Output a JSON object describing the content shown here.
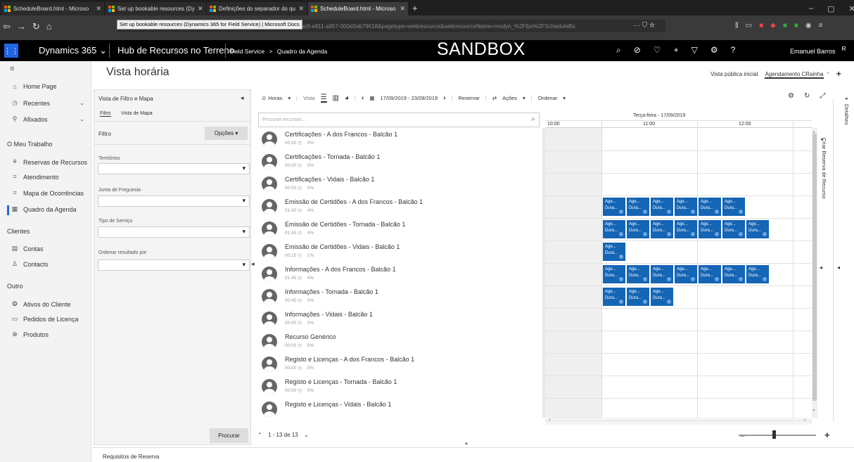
{
  "browser": {
    "tabs": [
      {
        "label": "ScheduleBoard.html - Microso"
      },
      {
        "label": "Set up bookable resources (Dy"
      },
      {
        "label": "Definições do separador do qu"
      },
      {
        "label": "ScheduleBoard.html - Microso"
      }
    ],
    "new_tab": "+",
    "tooltip": "Set up bookable resources (Dynamics 365 for Field Service) | Microsoft Docs",
    "url": "916005-6ac9-e811-a957-000d3ab79618&pagetype=webresource&webresourceName=msdyn_%2Ffps%2FScheduleBo",
    "url_icons": "··· ⛉ ☆",
    "window_controls": [
      "–",
      "▢",
      "✕"
    ]
  },
  "header": {
    "app_name": "Dynamics 365",
    "app_chevron": "⌄",
    "hub_name": "Hub de Recursos no Terreno",
    "breadcrumb_area": "Field Service",
    "breadcrumb_sep": ">",
    "breadcrumb_page": "Quadro da Agenda",
    "environment": "SANDBOX",
    "user": "Emanuel Barros"
  },
  "nav": {
    "items": [
      {
        "label": "Home Page"
      },
      {
        "label": "Recentes"
      },
      {
        "label": "Afixados"
      }
    ],
    "section_work": "O Meu Trabalho",
    "work_items": [
      {
        "label": "Reservas de Recursos"
      },
      {
        "label": "Atendimento"
      },
      {
        "label": "Mapa de Ocorrências"
      },
      {
        "label": "Quadro da Agenda"
      }
    ],
    "section_clients": "Clientes",
    "client_items": [
      {
        "label": "Contas"
      },
      {
        "label": "Contacts"
      }
    ],
    "section_other": "Outro",
    "other_items": [
      {
        "label": "Ativos do Cliente"
      },
      {
        "label": "Pedidos de Licença"
      },
      {
        "label": "Produtos"
      }
    ]
  },
  "page": {
    "title": "Vista horária",
    "view_public": "Vista pública inicial",
    "view_tab": "Agendamento CRainha",
    "view_close": "×",
    "add_view": "+"
  },
  "filter": {
    "pane_title": "Vista de Filtro e Mapa",
    "collapse": "◂",
    "tab_filter": "Filtro",
    "tab_map": "Vista de Mapa",
    "filter_label": "Filtro",
    "options_button": "Opções ▾",
    "fields": [
      "Territórios",
      "Junta de Freguesia",
      "Tipo de Serviço",
      "Ordenar resultado por"
    ],
    "search_button": "Procurar"
  },
  "toolbar": {
    "hours": "Horas",
    "view": "Vista",
    "date_range": "17/09/2019 - 23/09/2019",
    "reserve": "Reservar",
    "actions": "Ações",
    "sort": "Ordenar"
  },
  "search": {
    "placeholder": "Procurar recursos..."
  },
  "resources": [
    {
      "name": "Certificações - A dos Francos - Balcão 1",
      "hours": "00:00",
      "pct": "0%"
    },
    {
      "name": "Certificações - Tornada - Balcão 1",
      "hours": "00:00",
      "pct": "0%"
    },
    {
      "name": "Certificações - Vidais - Balcão 1",
      "hours": "00:00",
      "pct": "0%"
    },
    {
      "name": "Emissão de Certidões - A dos Francos - Balcão 1",
      "hours": "01:30",
      "pct": "4%"
    },
    {
      "name": "Emissão de Certidões - Tornada - Balcão 1",
      "hours": "01:45",
      "pct": "4%"
    },
    {
      "name": "Emissão de Certidões - Vidais - Balcão 1",
      "hours": "00:15",
      "pct": "1%"
    },
    {
      "name": "Informações - A dos Francos - Balcão 1",
      "hours": "01:45",
      "pct": "4%"
    },
    {
      "name": "Informações - Tornada - Balcão 1",
      "hours": "00:45",
      "pct": "2%"
    },
    {
      "name": "Informações - Vidais - Balcão 1",
      "hours": "00:00",
      "pct": "0%"
    },
    {
      "name": "Recurso Genérico",
      "hours": "00:00",
      "pct": "0%"
    },
    {
      "name": "Registo e Licenças - A dos Francos - Balcão 1",
      "hours": "00:00",
      "pct": "0%"
    },
    {
      "name": "Registo e Licenças - Tornada - Balcão 1",
      "hours": "00:00",
      "pct": "0%"
    },
    {
      "name": "Registo e Licenças - Vidais - Balcão 1",
      "hours": "",
      "pct": ""
    }
  ],
  "timeline": {
    "day": "Terça-feira - 17/09/2019",
    "hours": [
      "10:00",
      "11:00",
      "12:00"
    ],
    "booking_line1": "Age...",
    "booking_line2": "Dura...",
    "booking_counts": [
      0,
      0,
      0,
      6,
      7,
      1,
      7,
      3,
      0,
      0,
      0,
      0,
      0
    ]
  },
  "side": {
    "create_booking": "Criar Reserva de Recurso",
    "details": "Detalhes"
  },
  "pager": {
    "text": "1 - 13 de 13"
  },
  "footer": {
    "requirements": "Requisitos de Reserva"
  },
  "colors": {
    "accent": "#2266e3",
    "booking": "#1565b5"
  }
}
